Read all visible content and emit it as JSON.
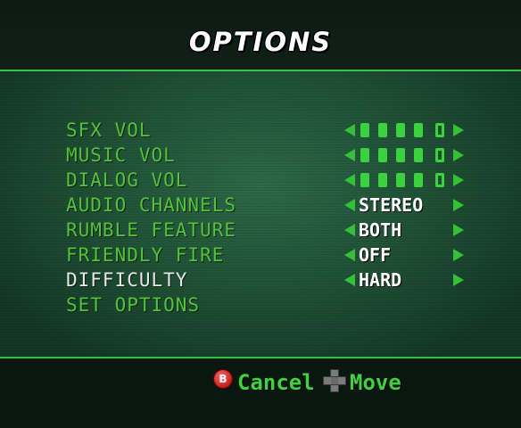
{
  "title": "OPTIONS",
  "colors": {
    "menu_text": "#54c23a",
    "selected_text": "#e8e8e8",
    "accent_green": "#35c038",
    "value_text": "#ffffff"
  },
  "menu": {
    "items": [
      {
        "label": "SFX VOL",
        "type": "slider",
        "level": 0.8
      },
      {
        "label": "MUSIC VOL",
        "type": "slider",
        "level": 0.8
      },
      {
        "label": "DIALOG VOL",
        "type": "slider",
        "level": 0.8
      },
      {
        "label": "AUDIO CHANNELS",
        "type": "select",
        "value": "STEREO"
      },
      {
        "label": "RUMBLE FEATURE",
        "type": "select",
        "value": "BOTH"
      },
      {
        "label": "FRIENDLY FIRE",
        "type": "select",
        "value": "OFF"
      },
      {
        "label": "DIFFICULTY",
        "type": "select",
        "value": "HARD",
        "selected": true
      },
      {
        "label": "SET OPTIONS",
        "type": "action"
      }
    ]
  },
  "footer": {
    "b_button": "B",
    "cancel_label": "Cancel",
    "move_label": "Move",
    "b_icon": "b-button-icon",
    "dpad_icon": "dpad-icon"
  }
}
